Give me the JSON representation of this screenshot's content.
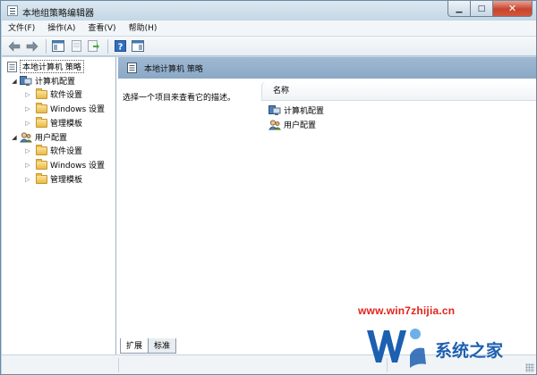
{
  "window": {
    "title": "本地组策略编辑器"
  },
  "window_controls": {
    "minimize": "▁",
    "maximize": "□",
    "close": "✕"
  },
  "menu": [
    {
      "label": "文件(F)"
    },
    {
      "label": "操作(A)"
    },
    {
      "label": "查看(V)"
    },
    {
      "label": "帮助(H)"
    }
  ],
  "toolbar": {
    "icons": [
      "back-arrow-icon",
      "forward-arrow-icon",
      "show-hide-tree-icon",
      "properties-icon",
      "export-list-icon",
      "help-icon",
      "show-hide-action-pane-icon"
    ]
  },
  "tree": {
    "root": "本地计算机 策略",
    "computer": "计算机配置",
    "computer_children": [
      "软件设置",
      "Windows 设置",
      "管理模板"
    ],
    "user": "用户配置",
    "user_children": [
      "软件设置",
      "Windows 设置",
      "管理模板"
    ]
  },
  "main": {
    "header": "本地计算机 策略",
    "description": "选择一个项目来查看它的描述。",
    "column_name": "名称",
    "items": [
      "计算机配置",
      "用户配置"
    ]
  },
  "tabs": [
    {
      "label": "扩展",
      "active": true
    },
    {
      "label": "标准",
      "active": false
    }
  ],
  "watermark": {
    "url": "www.win7zhijia.cn",
    "brand": "系统之家"
  },
  "colors": {
    "header_bg": "#8aa8c6",
    "window_frame": "#c0d6e4",
    "close_button": "#c8442d",
    "watermark_red": "#e2231a",
    "watermark_blue": "#1d5fb0"
  }
}
